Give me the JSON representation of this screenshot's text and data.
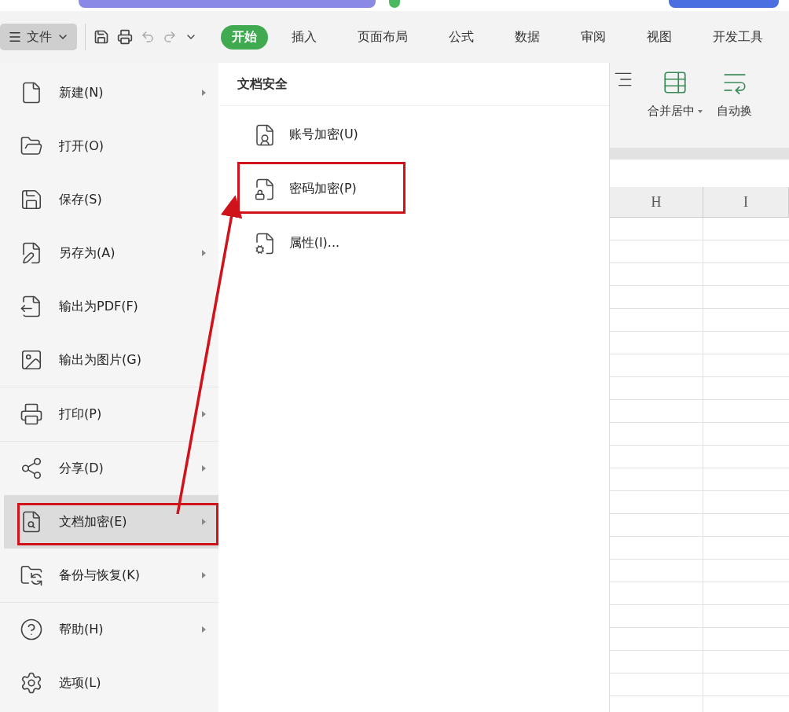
{
  "toolbar": {
    "file_menu": "文件",
    "tabs": [
      {
        "label": "开始",
        "selected": true
      },
      {
        "label": "插入",
        "selected": false
      },
      {
        "label": "页面布局",
        "selected": false
      },
      {
        "label": "公式",
        "selected": false
      },
      {
        "label": "数据",
        "selected": false
      },
      {
        "label": "审阅",
        "selected": false
      },
      {
        "label": "视图",
        "selected": false
      },
      {
        "label": "开发工具",
        "selected": false
      }
    ]
  },
  "ribbon": {
    "buttons": [
      {
        "kind": "merge",
        "label": "合并居中",
        "dropdown": true
      },
      {
        "kind": "wrap",
        "label": "自动换",
        "dropdown": false
      }
    ]
  },
  "sheet": {
    "columns": [
      "H",
      "I"
    ]
  },
  "file_menu": {
    "groups": [
      {
        "items": [
          {
            "kind": "new",
            "label": "新建(N)",
            "submenu": true,
            "selected": false,
            "outlined": false
          },
          {
            "kind": "open",
            "label": "打开(O)",
            "submenu": false,
            "selected": false,
            "outlined": false
          },
          {
            "kind": "save",
            "label": "保存(S)",
            "submenu": false,
            "selected": false,
            "outlined": false
          },
          {
            "kind": "saveas",
            "label": "另存为(A)",
            "submenu": true,
            "selected": false,
            "outlined": false
          },
          {
            "kind": "pdf",
            "label": "输出为PDF(F)",
            "submenu": false,
            "selected": false,
            "outlined": false
          },
          {
            "kind": "image",
            "label": "输出为图片(G)",
            "submenu": false,
            "selected": false,
            "outlined": false
          }
        ]
      },
      {
        "items": [
          {
            "kind": "print",
            "label": "打印(P)",
            "submenu": true,
            "selected": false,
            "outlined": false
          }
        ]
      },
      {
        "items": [
          {
            "kind": "share",
            "label": "分享(D)",
            "submenu": true,
            "selected": false,
            "outlined": false
          },
          {
            "kind": "encrypt",
            "label": "文档加密(E)",
            "submenu": true,
            "selected": true,
            "outlined": true
          },
          {
            "kind": "backup",
            "label": "备份与恢复(K)",
            "submenu": true,
            "selected": false,
            "outlined": false
          }
        ]
      },
      {
        "items": [
          {
            "kind": "help",
            "label": "帮助(H)",
            "submenu": true,
            "selected": false,
            "outlined": false
          },
          {
            "kind": "options",
            "label": "选项(L)",
            "submenu": false,
            "selected": false,
            "outlined": false
          }
        ]
      }
    ]
  },
  "submenu": {
    "title": "文档安全",
    "items": [
      {
        "kind": "account",
        "label": "账号加密(U)",
        "outlined": false
      },
      {
        "kind": "password",
        "label": "密码加密(P)",
        "outlined": true
      },
      {
        "kind": "properties",
        "label": "属性(I)...",
        "outlined": false
      }
    ]
  }
}
